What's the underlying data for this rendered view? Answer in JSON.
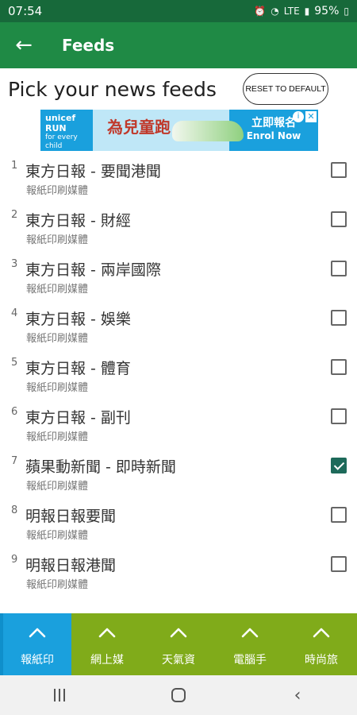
{
  "status_bar": {
    "time": "07:54",
    "battery": "95%",
    "network": "LTE"
  },
  "app_bar": {
    "title": "Feeds"
  },
  "heading": {
    "title": "Pick your news feeds",
    "reset_label": "RESET TO DEFAULT"
  },
  "ad": {
    "brand": "unicef",
    "run_text": "RUN",
    "tagline": "for every child",
    "calligraphy": "為兒童跑",
    "cta_line1": "立即報名",
    "cta_line2": "Enrol Now"
  },
  "feeds": [
    {
      "num": "1",
      "title": "東方日報 - 要聞港聞",
      "sub": "報紙印刷媒體",
      "checked": false
    },
    {
      "num": "2",
      "title": "東方日報 - 財經",
      "sub": "報紙印刷媒體",
      "checked": false
    },
    {
      "num": "3",
      "title": "東方日報 - 兩岸國際",
      "sub": "報紙印刷媒體",
      "checked": false
    },
    {
      "num": "4",
      "title": "東方日報 - 娛樂",
      "sub": "報紙印刷媒體",
      "checked": false
    },
    {
      "num": "5",
      "title": "東方日報 - 體育",
      "sub": "報紙印刷媒體",
      "checked": false
    },
    {
      "num": "6",
      "title": "東方日報 - 副刊",
      "sub": "報紙印刷媒體",
      "checked": false
    },
    {
      "num": "7",
      "title": "蘋果動新聞 - 即時新聞",
      "sub": "報紙印刷媒體",
      "checked": true
    },
    {
      "num": "8",
      "title": "明報日報要聞",
      "sub": "報紙印刷媒體",
      "checked": false
    },
    {
      "num": "9",
      "title": "明報日報港聞",
      "sub": "報紙印刷媒體",
      "checked": false
    }
  ],
  "tabs": [
    {
      "label": "報紙印",
      "active": true
    },
    {
      "label": "網上媒",
      "active": false
    },
    {
      "label": "天氣資",
      "active": false
    },
    {
      "label": "電腦手",
      "active": false
    },
    {
      "label": "時尚旅",
      "active": false
    }
  ],
  "colors": {
    "status": "#17693a",
    "appbar": "#1f8a45",
    "tabs": "#80ab1a",
    "tab_active": "#1aa0dd",
    "check": "#1d6a5a"
  }
}
